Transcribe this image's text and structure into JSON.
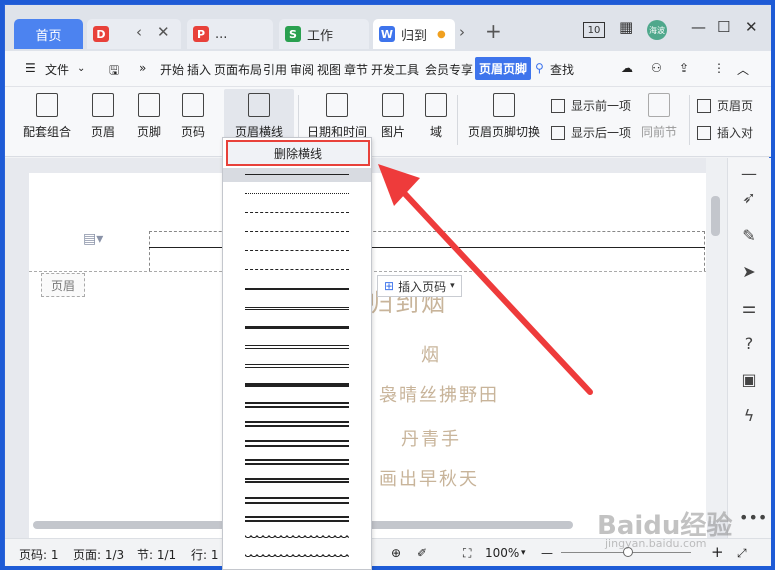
{
  "tabs": {
    "home": "首页",
    "tab2_label": "...",
    "tab3_label": "工作",
    "tab4_label": "归到"
  },
  "window": {
    "badge": "10",
    "avatar": "海波"
  },
  "menubar": {
    "file": "文件",
    "items": [
      "开始",
      "插入",
      "页面布局",
      "引用",
      "审阅",
      "视图",
      "章节",
      "开发工具",
      "会员专享"
    ],
    "active": "页眉页脚",
    "search": "查找"
  },
  "ribbon": {
    "combo": "配套组合",
    "header": "页眉",
    "footer": "页脚",
    "page_number": "页码",
    "header_line": "页眉横线",
    "datetime": "日期和时间",
    "picture": "图片",
    "field": "域",
    "switch": "页眉页脚切换",
    "show_prev": "显示前一项",
    "show_next": "显示后一项",
    "same_prev": "同前节",
    "header_top": "页眉页",
    "insert_align": "插入对"
  },
  "dropdown": {
    "remove_line": "删除横线"
  },
  "document": {
    "header_tag": "页眉",
    "insert_page_number": "插入页码",
    "title_fragment": "归到​烟",
    "poem": [
      "烟",
      "袅晴丝拂野田",
      "丹青手",
      "画出早秋天"
    ]
  },
  "statusbar": {
    "page_num": "页码: 1",
    "pages": "页面: 1/3",
    "section": "节: 1/1",
    "row": "行: 1",
    "zoom": "100%"
  },
  "watermark": {
    "main": "Baidu经验",
    "sub": "jingyan.baidu.com"
  },
  "colors": {
    "accent": "#3e74ec",
    "highlight": "#e8413a",
    "tabbar": "#dfe3ea"
  }
}
